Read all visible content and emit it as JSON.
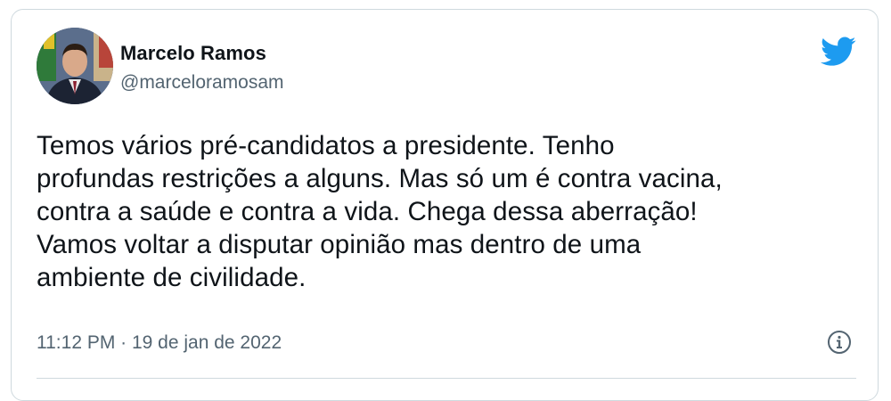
{
  "tweet": {
    "author_name": "Marcelo Ramos",
    "author_handle": "@marceloramosam",
    "text": "Temos vários pré-candidatos a presidente. Tenho\nprofundas restrições a alguns. Mas só um é contra vacina,\ncontra a saúde e contra a vida. Chega dessa aberração!\nVamos voltar a disputar opinião mas dentro de uma\nambiente de civilidade.",
    "timestamp": "11:12 PM · 19 de jan de 2022"
  },
  "icons": {
    "brand": "twitter-bird-icon",
    "info": "info-icon"
  },
  "colors": {
    "brand": "#1d9bf0",
    "text_primary": "#0f1419",
    "text_secondary": "#536471",
    "border": "#cfd9de"
  }
}
